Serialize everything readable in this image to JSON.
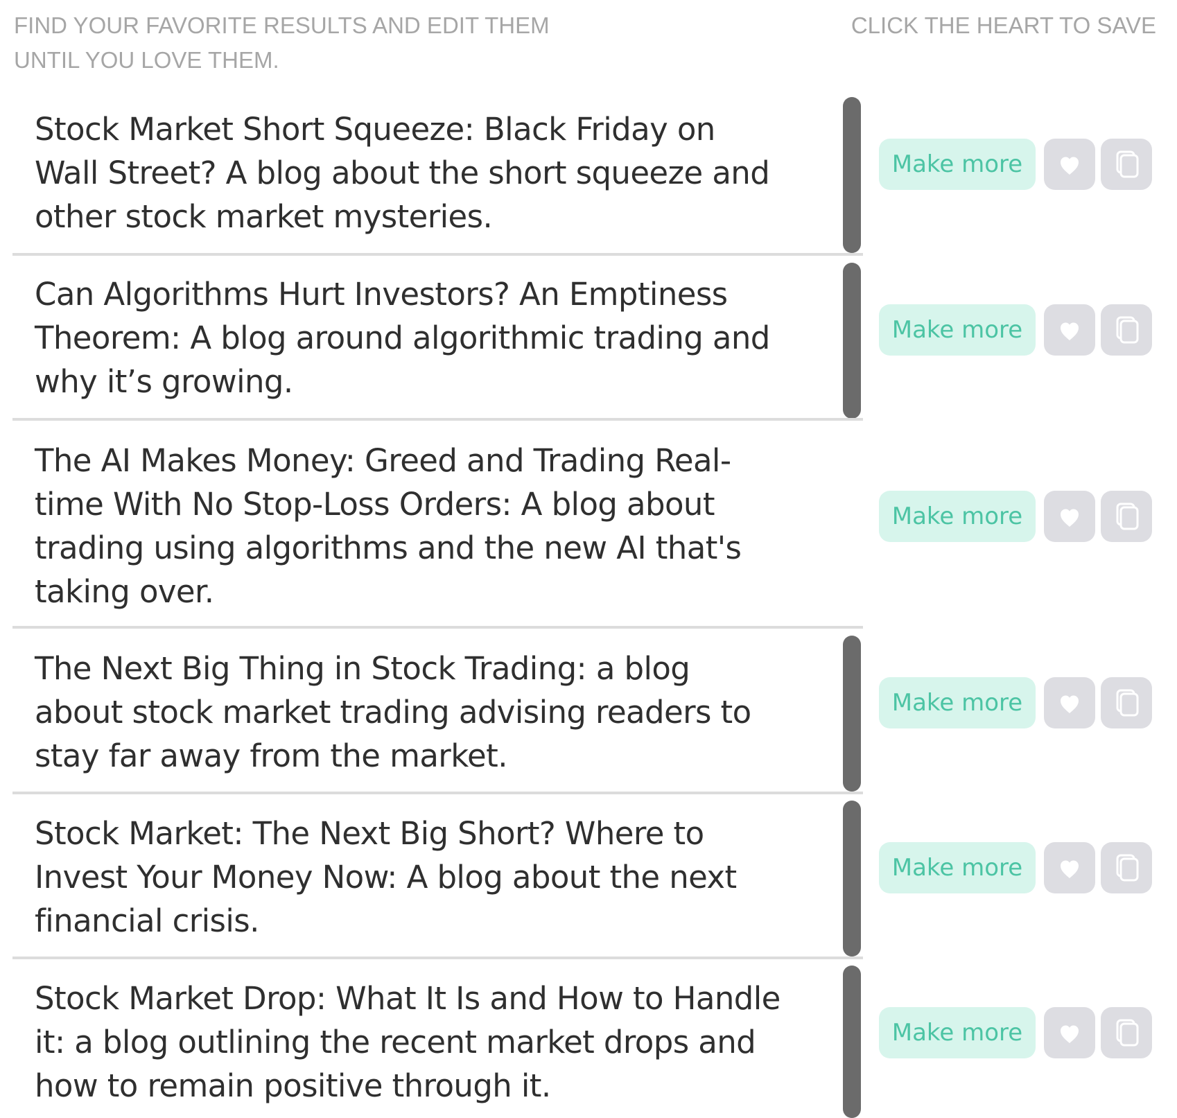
{
  "header": {
    "left_line_1": "FIND YOUR FAVORITE RESULTS AND EDIT THEM",
    "left_line_2": "UNTIL YOU LOVE THEM.",
    "right": "CLICK THE HEART TO SAVE"
  },
  "results": [
    {
      "lines": [
        "Stock Market Short Squeeze: Black Friday on",
        "Wall Street? A blog about the short squeeze and",
        "other stock market mysteries."
      ],
      "make_more_label": "Make more"
    },
    {
      "lines": [
        "Can Algorithms Hurt Investors? An Emptiness",
        "Theorem: A blog around algorithmic trading and",
        "why it’s growing."
      ],
      "make_more_label": "Make more"
    },
    {
      "lines": [
        "The AI Makes Money: Greed and Trading Real-",
        "time With No Stop-Loss Orders: A blog about",
        "trading using algorithms and the new AI that's",
        "taking over."
      ],
      "make_more_label": "Make more"
    },
    {
      "lines": [
        "The Next Big Thing in Stock Trading: a blog",
        "about stock market trading advising readers to",
        "stay far away from the market."
      ],
      "make_more_label": "Make more"
    },
    {
      "lines": [
        "Stock Market: The Next Big Short? Where to",
        "Invest Your Money Now: A blog about the next",
        "financial crisis."
      ],
      "make_more_label": "Make more"
    },
    {
      "lines": [
        "Stock Market Drop: What It Is and How to Handle",
        "it: a blog outlining the recent market drops and",
        "how to remain positive through it."
      ],
      "make_more_label": "Make more"
    }
  ],
  "icons": {
    "heart": "heart-icon",
    "copy": "copy-icon"
  },
  "colors": {
    "header_text": "#a6a6a6",
    "result_text": "#2f2f2f",
    "make_more_bg": "#d7f5ec",
    "make_more_text": "#4cc4a4",
    "icon_button_bg": "#dddde2",
    "divider": "#dcdcdc",
    "bar": "#6b6b6b"
  }
}
